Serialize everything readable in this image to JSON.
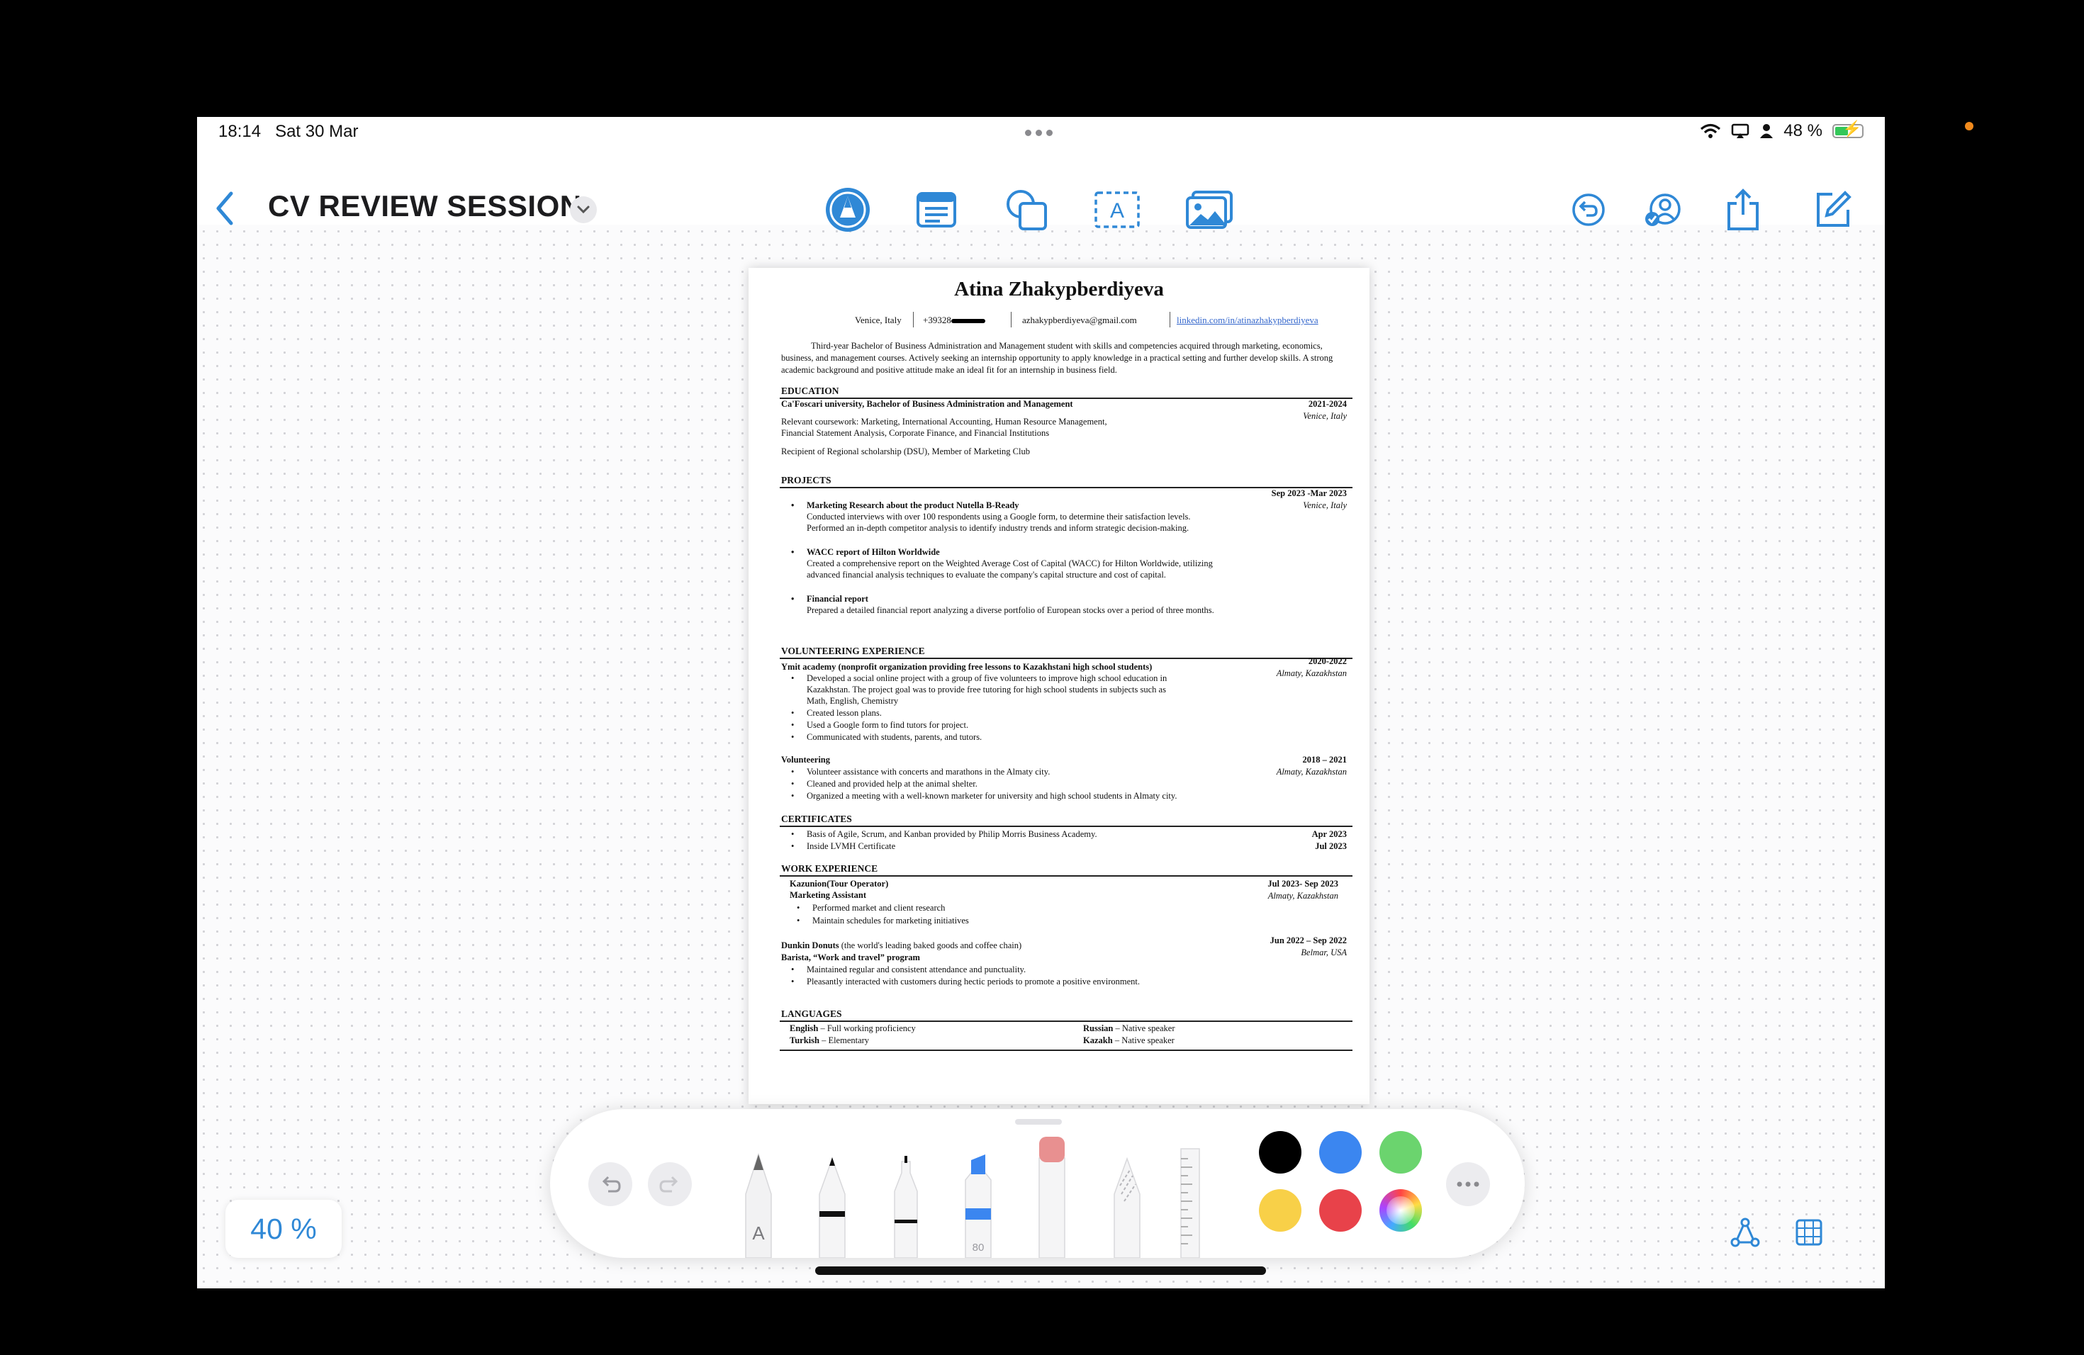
{
  "status_bar": {
    "time": "18:14",
    "date": "Sat 30 Mar",
    "battery": "48 %"
  },
  "toolbar": {
    "title": "CV REVIEW SESSION",
    "left_icons": [
      "back-chevron-icon",
      "title-dropdown-icon"
    ],
    "center_icons": [
      "pen-tool-icon",
      "text-box-icon",
      "shapes-icon",
      "text-insert-icon",
      "media-icon"
    ],
    "right_icons": [
      "undo-history-icon",
      "collaborate-icon",
      "share-icon",
      "new-board-icon"
    ]
  },
  "cv": {
    "name": "Atina Zhakypberdiyeva",
    "contact": {
      "city": "Venice, Italy",
      "phone": "+39328",
      "email": "azhakypberdiyeva@gmail.com",
      "linkedin": "linkedin.com/in/atinazhakypberdiyeva"
    },
    "summary": "Third-year Bachelor of Business Administration and Management student with skills and competencies acquired through marketing, economics, business, and management courses. Actively seeking an internship opportunity to apply knowledge in a practical setting and further develop skills. A strong academic background and positive attitude make an ideal fit for an internship in business field.",
    "education": {
      "heading": "EDUCATION",
      "school": "Ca'Foscari university, Bachelor of Business Administration and Management",
      "dates": "2021-2024",
      "place": "Venice, Italy",
      "coursework_1": "Relevant coursework: Marketing, International Accounting, Human Resource Management,",
      "coursework_2": "Financial Statement Analysis, Corporate Finance, and Financial Institutions",
      "awards": "Recipient of Regional scholarship (DSU), Member of Marketing Club"
    },
    "projects": {
      "heading": "PROJECTS",
      "dates": "Sep 2023 -Mar 2023",
      "place": "Venice, Italy",
      "p1_title": "Marketing Research about the product Nutella B-Ready",
      "p1_l1": "Conducted interviews with over 100 respondents using a Google form, to determine their satisfaction levels.",
      "p1_l2": "Performed an in-depth competitor analysis to identify industry trends and inform strategic decision-making.",
      "p2_title": "WACC report of Hilton Worldwide",
      "p2_l1": "Created a comprehensive report on the Weighted Average Cost of Capital (WACC) for Hilton Worldwide, utilizing",
      "p2_l2": "advanced financial analysis techniques to evaluate the company's capital structure and cost of capital.",
      "p3_title": "Financial report",
      "p3_l1": "Prepared a detailed financial report analyzing a diverse portfolio of European stocks over a period of three months."
    },
    "volunteering": {
      "heading": "VOLUNTEERING EXPERIENCE",
      "org": "Ymit academy (nonprofit organization providing free lessons to Kazakhstani high school students)",
      "dates_1": "2020-2022",
      "place_1": "Almaty, Kazakhstan",
      "b1_l1": "Developed a social online project with a group of five volunteers to improve high school education in",
      "b1_l2": "Kazakhstan. The project goal was to provide free tutoring for high school students in subjects such as",
      "b1_l3": "Math, English, Chemistry",
      "b2": "Created lesson plans.",
      "b3": "Used a Google form to find tutors for project.",
      "b4": "Communicated with students, parents, and tutors.",
      "v2_title": "Volunteering",
      "dates_2": "2018 – 2021",
      "place_2": "Almaty, Kazakhstan",
      "v2_b1": "Volunteer assistance with concerts and marathons in the Almaty city.",
      "v2_b2": "Cleaned and provided help at the animal shelter.",
      "v2_b3": "Organized a meeting with a well-known marketer for university and high school students in Almaty city."
    },
    "certificates": {
      "heading": "CERTIFICATES",
      "c1": "Basis of Agile, Scrum, and Kanban provided by Philip Morris Business Academy.",
      "c1_date": "Apr 2023",
      "c2": "Inside LVMH Certificate",
      "c2_date": "Jul 2023"
    },
    "work": {
      "heading": "WORK EXPERIENCE",
      "j1_company": "Kazunion(Tour Operator)",
      "j1_role": "Marketing Assistant",
      "j1_dates": "Jul 2023- Sep 2023",
      "j1_place": "Almaty, Kazakhstan",
      "j1_b1": "Performed market and client research",
      "j1_b2": "Maintain schedules for marketing initiatives",
      "j2_company": "Dunkin Donuts",
      "j2_desc": "(the world's leading baked goods and coffee chain)",
      "j2_role": "Barista, “Work and travel” program",
      "j2_dates": "Jun 2022 – Sep 2022",
      "j2_place": "Belmar, USA",
      "j2_b1": "Maintained regular and consistent attendance and punctuality.",
      "j2_b2": "Pleasantly interacted with customers during hectic periods to promote a positive environment."
    },
    "languages": {
      "heading": "LANGUAGES",
      "l1_name": "English",
      "l1_level": "– Full working proficiency",
      "l2_name": "Turkish",
      "l2_level": "– Elementary",
      "l3_name": "Russian",
      "l3_level": "– Native speaker",
      "l4_name": "Kazakh",
      "l4_level": "– Native speaker"
    }
  },
  "palette": {
    "pencil_label": "A",
    "marker_size": "80",
    "colors": {
      "black": "#000000",
      "blue": "#3b86f0",
      "green": "#6bd46e",
      "yellow": "#f8d048",
      "red": "#e8424a"
    }
  },
  "zoom_level": "40 %"
}
